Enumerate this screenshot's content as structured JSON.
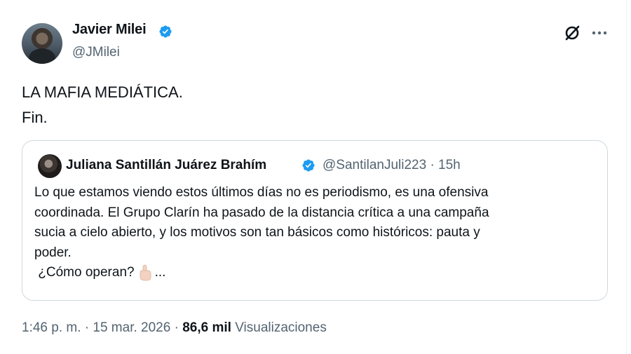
{
  "author": {
    "name": "Javier Milei",
    "handle": "@JMilei"
  },
  "tweet": {
    "lines": [
      "LA MAFIA MEDIÁTICA.",
      "Fin."
    ]
  },
  "quote": {
    "name": "Juliana Santillán Juárez Brahím",
    "handle_time": "@SantilanJuli223 · 15h",
    "lines": [
      "Lo que estamos viendo estos últimos días no es periodismo, es una ofensiva",
      "coordinada. El Grupo Clarín ha pasado de la distancia crítica a una campaña",
      "sucia a cielo abierto, y los motivos son tan básicos como históricos: pauta y",
      "poder."
    ],
    "last_line": " ¿Cómo operan?",
    "ellipsis": "..."
  },
  "meta": {
    "time": "1:46 p. m.",
    "date": "15 mar. 2026",
    "views_count": "86,6 mil",
    "views_label": "Visualizaciones",
    "separator": " · "
  },
  "colors": {
    "verified": "#1d9bf0",
    "text": "#0f1419",
    "secondary": "#536471",
    "border": "#cfd9de"
  },
  "icons": {
    "grok": "grok-icon",
    "more": "more-icon",
    "verified": "verified-badge-icon",
    "hand": "index-pointing-up-emoji"
  }
}
